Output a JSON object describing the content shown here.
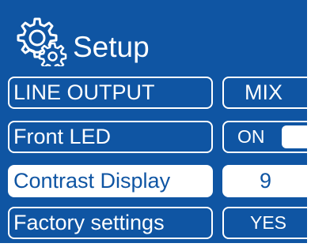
{
  "header": {
    "title": "Setup",
    "icon": "gear-icon"
  },
  "menu": [
    {
      "label": "LINE OUTPUT",
      "value": "MIX",
      "selected": false
    },
    {
      "label": "Front LED",
      "value": "ON",
      "control": "toggle",
      "toggle_on": true,
      "selected": false
    },
    {
      "label": "Contrast Display",
      "value": "9",
      "selected": true
    },
    {
      "label": "Factory settings",
      "value": "YES",
      "selected": false
    }
  ],
  "colors": {
    "background": "#0f55a3",
    "foreground": "#ffffff"
  }
}
